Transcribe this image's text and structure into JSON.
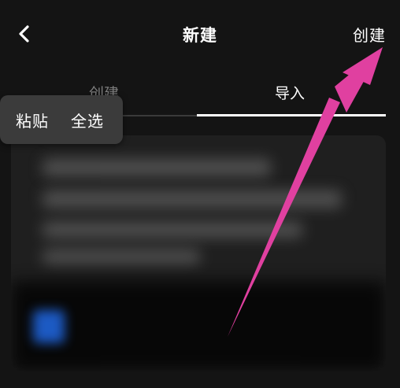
{
  "header": {
    "back_icon": "chevron-left-icon",
    "title": "新建",
    "create_label": "创建"
  },
  "tabs": [
    {
      "label": "创建",
      "active": false
    },
    {
      "label": "导入",
      "active": true
    }
  ],
  "context_menu": {
    "paste_label": "粘贴",
    "select_all_label": "全选"
  },
  "annotation": {
    "arrow_color": "#e040a0"
  },
  "colors": {
    "background": "#141414",
    "panel": "#1f1f1f",
    "menu": "#3b3b3b",
    "inactive_text": "#7d7d7d"
  }
}
